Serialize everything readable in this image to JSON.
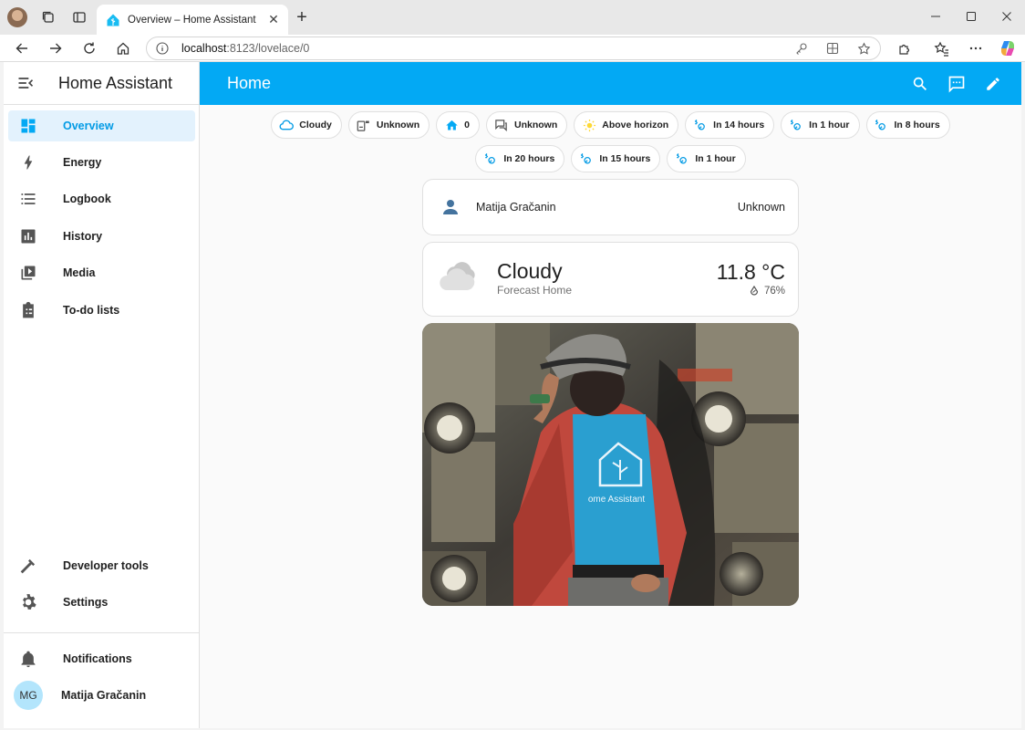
{
  "browser": {
    "tab_title": "Overview – Home Assistant",
    "url_host": "localhost",
    "url_rest": ":8123/lovelace/0"
  },
  "sidebar": {
    "title": "Home Assistant",
    "items": [
      {
        "label": "Overview",
        "icon": "dashboard-icon"
      },
      {
        "label": "Energy",
        "icon": "lightning-icon"
      },
      {
        "label": "Logbook",
        "icon": "list-icon"
      },
      {
        "label": "History",
        "icon": "chart-bar-icon"
      },
      {
        "label": "Media",
        "icon": "play-box-icon"
      },
      {
        "label": "To-do lists",
        "icon": "clipboard-list-icon"
      }
    ],
    "bottom_items": [
      {
        "label": "Developer tools",
        "icon": "hammer-icon"
      },
      {
        "label": "Settings",
        "icon": "gear-icon"
      }
    ],
    "notifications_label": "Notifications",
    "user_initials": "MG",
    "user_name": "Matija Gračanin"
  },
  "header": {
    "title": "Home"
  },
  "badges": [
    {
      "label": "Cloudy",
      "icon": "cloud-icon"
    },
    {
      "label": "Unknown",
      "icon": "devices-icon"
    },
    {
      "label": "0",
      "icon": "home-icon"
    },
    {
      "label": "Unknown",
      "icon": "message-icon"
    },
    {
      "label": "Above horizon",
      "icon": "sun-icon"
    },
    {
      "label": "In 14 hours",
      "icon": "weather-sunset-icon"
    },
    {
      "label": "In 1 hour",
      "icon": "weather-sunset-icon"
    },
    {
      "label": "In 8 hours",
      "icon": "weather-sunset-icon"
    },
    {
      "label": "In 20 hours",
      "icon": "weather-sunset-icon"
    },
    {
      "label": "In 15 hours",
      "icon": "weather-sunset-icon"
    },
    {
      "label": "In 1 hour",
      "icon": "weather-sunset-icon"
    }
  ],
  "person_card": {
    "name": "Matija Gračanin",
    "state": "Unknown"
  },
  "weather_card": {
    "condition": "Cloudy",
    "name": "Forecast Home",
    "temperature": "11.8 °C",
    "humidity": "76%"
  },
  "picture_card": {
    "shirt_text": "ome Assistant"
  },
  "colors": {
    "primary": "#03a9f4",
    "sidebar_active_bg": "#e3f2fd",
    "person_icon": "#44739e"
  }
}
